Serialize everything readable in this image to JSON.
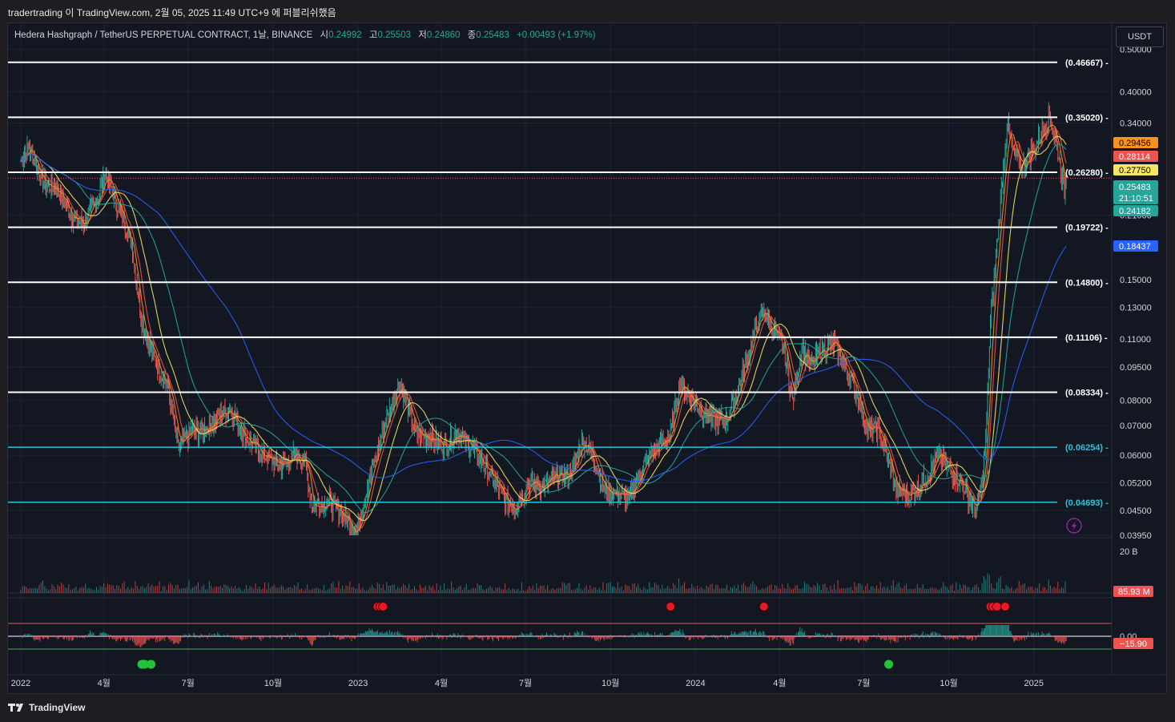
{
  "header": {
    "text": "tradertrading 이 TradingView.com, 2월 05, 2025 11:49 UTC+9 에 퍼블리쉬했음"
  },
  "legend": {
    "title": "Hedera Hashgraph / TetherUS PERPETUAL CONTRACT, 1날, BINANCE",
    "open_label": "시",
    "open": "0.24992",
    "high_label": "고",
    "high": "0.25503",
    "low_label": "저",
    "low": "0.24860",
    "close_label": "종",
    "close": "0.25483",
    "change": "+0.00493 (+1.97%)"
  },
  "currency": "USDT",
  "footer": {
    "brand": "TradingView"
  },
  "colors": {
    "bg": "#131722",
    "up": "#26a69a",
    "down": "#ef5350",
    "ma_orange": "#f7931a",
    "ma_yellow": "#f5e663",
    "ma_green": "#26a69a",
    "ma_blue": "#2962ff",
    "white_level": "#ffffff",
    "cyan_level": "#26c6da"
  },
  "chart_data": {
    "type": "line",
    "title": "Hedera Hashgraph / TetherUS PERPETUAL CONTRACT, 1날, BINANCE",
    "y_scale": "log",
    "ylim": [
      0.0395,
      0.57
    ],
    "y_ticks": [
      "0.50000",
      "0.40000",
      "0.34000",
      "0.21000",
      "0.15000",
      "0.13000",
      "0.11000",
      "0.09500",
      "0.08000",
      "0.07000",
      "0.06000",
      "0.05200",
      "0.04500",
      "0.03950"
    ],
    "x_ticks": [
      "2022",
      "4월",
      "7월",
      "10월",
      "2023",
      "4월",
      "7월",
      "10월",
      "2024",
      "4월",
      "7월",
      "10월",
      "2025"
    ],
    "x_tick_dates": [
      "2022-01-01",
      "2022-04-01",
      "2022-07-01",
      "2022-10-01",
      "2023-01-01",
      "2023-04-01",
      "2023-07-01",
      "2023-10-01",
      "2024-01-01",
      "2024-04-01",
      "2024-07-01",
      "2024-10-01",
      "2025-01-01"
    ],
    "horizontal_levels": [
      {
        "value": 0.46667,
        "label": "(0.46667)",
        "color": "#ffffff"
      },
      {
        "value": 0.3502,
        "label": "(0.35020)",
        "color": "#ffffff"
      },
      {
        "value": 0.2628,
        "label": "(0.26280)",
        "color": "#ffffff"
      },
      {
        "value": 0.19722,
        "label": "(0.19722)",
        "color": "#ffffff"
      },
      {
        "value": 0.148,
        "label": "(0.14800)",
        "color": "#ffffff"
      },
      {
        "value": 0.11106,
        "label": "(0.11106)",
        "color": "#ffffff"
      },
      {
        "value": 0.08334,
        "label": "(0.08334)",
        "color": "#ffffff"
      },
      {
        "value": 0.06254,
        "label": "(0.06254)",
        "color": "#26c6da"
      },
      {
        "value": 0.04693,
        "label": "(0.04693)",
        "color": "#26c6da"
      }
    ],
    "price_points": [
      [
        "2022-01-01",
        0.28
      ],
      [
        "2022-01-10",
        0.3
      ],
      [
        "2022-01-25",
        0.25
      ],
      [
        "2022-02-10",
        0.24
      ],
      [
        "2022-02-25",
        0.21
      ],
      [
        "2022-03-10",
        0.2
      ],
      [
        "2022-03-25",
        0.23
      ],
      [
        "2022-04-03",
        0.26
      ],
      [
        "2022-04-20",
        0.21
      ],
      [
        "2022-05-01",
        0.18
      ],
      [
        "2022-05-12",
        0.12
      ],
      [
        "2022-05-25",
        0.1
      ],
      [
        "2022-06-10",
        0.085
      ],
      [
        "2022-06-20",
        0.062
      ],
      [
        "2022-07-05",
        0.068
      ],
      [
        "2022-07-20",
        0.069
      ],
      [
        "2022-08-05",
        0.074
      ],
      [
        "2022-08-15",
        0.077
      ],
      [
        "2022-09-01",
        0.066
      ],
      [
        "2022-09-20",
        0.06
      ],
      [
        "2022-10-10",
        0.057
      ],
      [
        "2022-10-25",
        0.06
      ],
      [
        "2022-11-05",
        0.058
      ],
      [
        "2022-11-12",
        0.046
      ],
      [
        "2022-12-01",
        0.047
      ],
      [
        "2022-12-20",
        0.043
      ],
      [
        "2022-12-30",
        0.04
      ],
      [
        "2023-01-10",
        0.05
      ],
      [
        "2023-01-25",
        0.065
      ],
      [
        "2023-02-05",
        0.077
      ],
      [
        "2023-02-15",
        0.088
      ],
      [
        "2023-03-05",
        0.067
      ],
      [
        "2023-03-20",
        0.066
      ],
      [
        "2023-04-05",
        0.063
      ],
      [
        "2023-04-18",
        0.068
      ],
      [
        "2023-05-05",
        0.062
      ],
      [
        "2023-05-25",
        0.054
      ],
      [
        "2023-06-10",
        0.047
      ],
      [
        "2023-06-20",
        0.046
      ],
      [
        "2023-07-05",
        0.052
      ],
      [
        "2023-07-20",
        0.051
      ],
      [
        "2023-08-05",
        0.054
      ],
      [
        "2023-08-20",
        0.055
      ],
      [
        "2023-09-01",
        0.065
      ],
      [
        "2023-09-10",
        0.061
      ],
      [
        "2023-09-25",
        0.05
      ],
      [
        "2023-10-10",
        0.049
      ],
      [
        "2023-10-22",
        0.048
      ],
      [
        "2023-11-05",
        0.057
      ],
      [
        "2023-11-20",
        0.062
      ],
      [
        "2023-12-05",
        0.067
      ],
      [
        "2023-12-15",
        0.088
      ],
      [
        "2023-12-25",
        0.082
      ],
      [
        "2024-01-05",
        0.077
      ],
      [
        "2024-01-20",
        0.072
      ],
      [
        "2024-02-05",
        0.073
      ],
      [
        "2024-02-20",
        0.09
      ],
      [
        "2024-03-05",
        0.115
      ],
      [
        "2024-03-15",
        0.128
      ],
      [
        "2024-03-25",
        0.115
      ],
      [
        "2024-04-05",
        0.106
      ],
      [
        "2024-04-15",
        0.08
      ],
      [
        "2024-04-25",
        0.105
      ],
      [
        "2024-05-05",
        0.095
      ],
      [
        "2024-05-15",
        0.104
      ],
      [
        "2024-05-30",
        0.107
      ],
      [
        "2024-06-15",
        0.092
      ],
      [
        "2024-06-25",
        0.081
      ],
      [
        "2024-07-05",
        0.068
      ],
      [
        "2024-07-15",
        0.069
      ],
      [
        "2024-07-25",
        0.061
      ],
      [
        "2024-08-05",
        0.05
      ],
      [
        "2024-08-20",
        0.049
      ],
      [
        "2024-09-05",
        0.053
      ],
      [
        "2024-09-20",
        0.06
      ],
      [
        "2024-10-01",
        0.056
      ],
      [
        "2024-10-15",
        0.052
      ],
      [
        "2024-10-30",
        0.045
      ],
      [
        "2024-11-05",
        0.05
      ],
      [
        "2024-11-10",
        0.065
      ],
      [
        "2024-11-15",
        0.12
      ],
      [
        "2024-11-20",
        0.16
      ],
      [
        "2024-12-03",
        0.34
      ],
      [
        "2024-12-10",
        0.29
      ],
      [
        "2024-12-20",
        0.27
      ],
      [
        "2025-01-05",
        0.31
      ],
      [
        "2025-01-18",
        0.35
      ],
      [
        "2025-01-25",
        0.31
      ],
      [
        "2025-02-03",
        0.24
      ],
      [
        "2025-02-05",
        0.2548
      ]
    ],
    "series": [
      {
        "name": "",
        "current_value": "0.29456",
        "color": "#f7931a"
      },
      {
        "name": "",
        "current_value": "0.28114",
        "color": "#ef5350"
      },
      {
        "name": "",
        "current_value": "0.27750",
        "color": "#f5e663"
      },
      {
        "name": "",
        "current_value": "0.24182",
        "color": "#26a69a"
      },
      {
        "name": "",
        "current_value": "0.18437",
        "color": "#2962ff"
      }
    ],
    "last_price": {
      "value": "0.25483",
      "countdown": "21:10:51"
    },
    "volume": {
      "axis_label": "20 B",
      "current": "85.93 M"
    },
    "oscillator": {
      "zero_label": "0.00",
      "current": "−15.90"
    },
    "red_signals": [
      "2023-01-22",
      "2023-01-25",
      "2023-01-28",
      "2023-12-05",
      "2024-03-15",
      "2024-11-15",
      "2024-11-18",
      "2024-11-22",
      "2024-12-01"
    ],
    "green_signals": [
      "2022-05-12",
      "2022-05-15",
      "2022-05-22",
      "2024-07-28"
    ],
    "grid": true
  }
}
